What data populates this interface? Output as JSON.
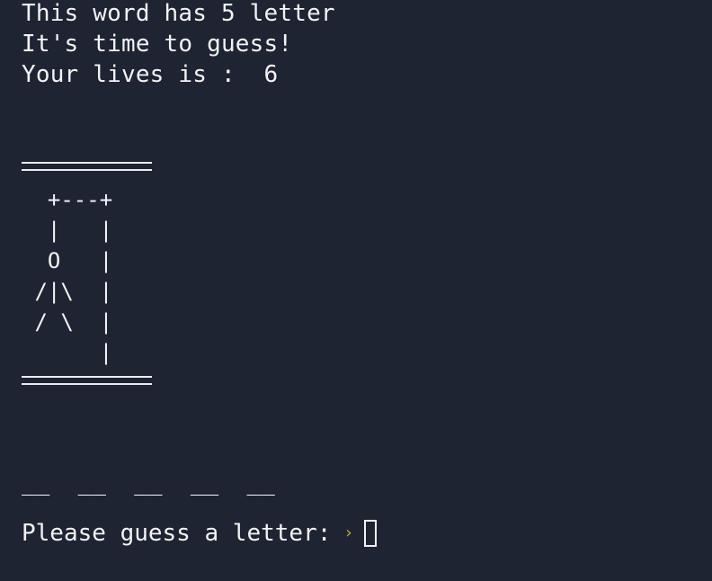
{
  "header": {
    "word_info": "This word has 5 letter",
    "guess_msg": "It's time to guess!",
    "lives_label": "Your lives is :  6"
  },
  "hangman": {
    "top_rule": "=========",
    "art": "  +---+\n  |   |\n  O   |\n /|\\  |\n / \\  |\n      |",
    "bottom_rule": "========="
  },
  "word_slots": "__  __  __  __  __",
  "prompt": {
    "text": "Please guess a letter:",
    "arrow_icon": "prompt-arrow-icon",
    "arrow_glyph": "›",
    "arrow_color": "#c9a64b"
  },
  "colors": {
    "background": "#1f2433",
    "foreground": "#f2f3f5"
  }
}
